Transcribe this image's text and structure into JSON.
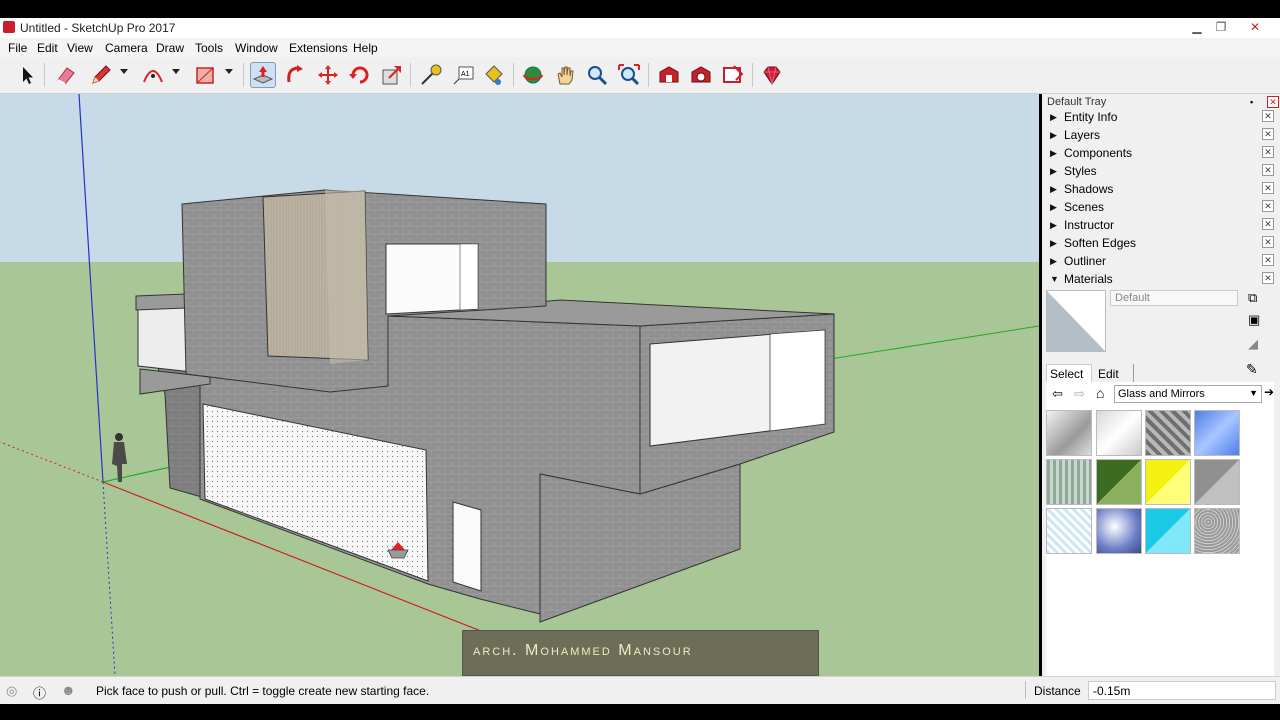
{
  "window": {
    "title": "Untitled - SketchUp Pro 2017",
    "minimize": "▁",
    "restore": "❐",
    "close": "✕"
  },
  "menu": [
    "File",
    "Edit",
    "View",
    "Camera",
    "Draw",
    "Tools",
    "Window",
    "Extensions",
    "Help"
  ],
  "toolbar": {
    "icons": [
      "select-icon",
      "eraser-icon",
      "pencil-icon",
      "arc-icon",
      "rectangle-icon",
      "push-pull-icon",
      "follow-me-icon",
      "move-icon",
      "rotate-icon",
      "scale-icon",
      "tape-measure-icon",
      "text-icon",
      "paint-bucket-icon",
      "orbit-icon",
      "pan-icon",
      "zoom-icon",
      "zoom-extents-icon",
      "warehouse-icon",
      "extension-warehouse-icon",
      "layout-icon",
      "ruby-icon"
    ]
  },
  "tray": {
    "title": "Default Tray",
    "panels": [
      "Entity Info",
      "Layers",
      "Components",
      "Styles",
      "Shadows",
      "Scenes",
      "Instructor",
      "Soften Edges",
      "Outliner",
      "Materials"
    ],
    "materials": {
      "current_name": "Default",
      "tab_select": "Select",
      "tab_edit": "Edit",
      "library": "Glass and Mirrors"
    }
  },
  "watermark": "arch. Mohammed Mansour",
  "status": {
    "message": "Pick face to push or pull.  Ctrl = toggle create new starting face.",
    "measure_label": "Distance",
    "measure_value": "-0.15m"
  },
  "colors": {
    "sky": "#c6dbe7",
    "ground": "#a9c796",
    "wall": "#8f8f8f",
    "accent_red": "#c8202a"
  }
}
